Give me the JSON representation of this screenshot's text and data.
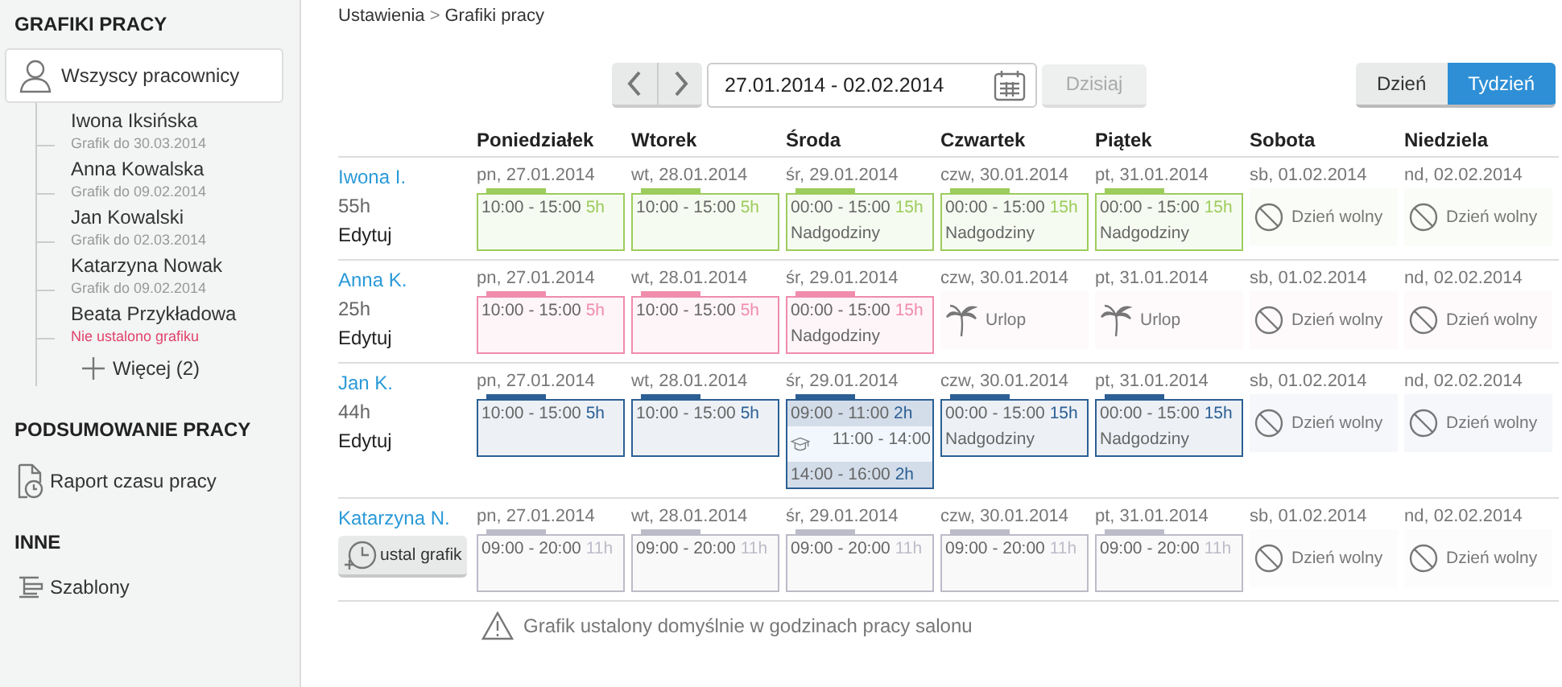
{
  "sidebar": {
    "schedules_title": "GRAFIKI PRACY",
    "all_item": {
      "label": "Wszyscy pracownicy",
      "selected": true
    },
    "employees": [
      {
        "name": "Iwona Iksińska",
        "sub": "Grafik do 30.03.2014",
        "warning": false
      },
      {
        "name": "Anna Kowalska",
        "sub": "Grafik do 09.02.2014",
        "warning": false
      },
      {
        "name": "Jan Kowalski",
        "sub": "Grafik do 02.03.2014",
        "warning": false
      },
      {
        "name": "Katarzyna Nowak",
        "sub": "Grafik do 09.02.2014",
        "warning": false
      },
      {
        "name": "Beata Przykładowa",
        "sub": "Nie ustalono grafiku",
        "warning": true
      }
    ],
    "more": "Więcej (2)",
    "summary_title": "PODSUMOWANIE PRACY",
    "report_item": "Raport czasu pracy",
    "other_title": "INNE",
    "templates_item": "Szablony"
  },
  "breadcrumb": {
    "items": [
      "Ustawienia",
      "Grafiki pracy"
    ],
    "separator": ">"
  },
  "toolbar": {
    "date_range": "27.01.2014 - 02.02.2014",
    "today": {
      "label": "Dzisiaj",
      "disabled": true
    },
    "views": [
      {
        "label": "Dzień",
        "selected": false
      },
      {
        "label": "Tydzień",
        "selected": true
      }
    ]
  },
  "day_headers": [
    "Poniedziałek",
    "Wtorek",
    "Środa",
    "Czwartek",
    "Piątek",
    "Sobota",
    "Niedziela"
  ],
  "rows": [
    {
      "name": "Iwona I.",
      "hours": "55h",
      "action": {
        "kind": "link",
        "label": "Edytuj"
      },
      "color": "#9ccc5c",
      "days": [
        {
          "date": "pn, 27.01.2014",
          "kind": "shift",
          "segments": [
            {
              "kind": "work",
              "time": "10:00 - 15:00",
              "hours": "5h"
            }
          ]
        },
        {
          "date": "wt, 28.01.2014",
          "kind": "shift",
          "segments": [
            {
              "kind": "work",
              "time": "10:00 - 15:00",
              "hours": "5h"
            }
          ]
        },
        {
          "date": "śr, 29.01.2014",
          "kind": "shift",
          "segments": [
            {
              "kind": "work",
              "time": "00:00 - 15:00",
              "hours": "15h",
              "note": "Nadgodziny"
            }
          ]
        },
        {
          "date": "czw, 30.01.2014",
          "kind": "shift",
          "segments": [
            {
              "kind": "work",
              "time": "00:00 - 15:00",
              "hours": "15h",
              "note": "Nadgodziny"
            }
          ]
        },
        {
          "date": "pt, 31.01.2014",
          "kind": "shift",
          "segments": [
            {
              "kind": "work",
              "time": "00:00 - 15:00",
              "hours": "15h",
              "note": "Nadgodziny"
            }
          ]
        },
        {
          "date": "sb, 01.02.2014",
          "kind": "off",
          "label": "Dzień wolny"
        },
        {
          "date": "nd, 02.02.2014",
          "kind": "off",
          "label": "Dzień wolny"
        }
      ]
    },
    {
      "name": "Anna K.",
      "hours": "25h",
      "action": {
        "kind": "link",
        "label": "Edytuj"
      },
      "color": "#f08cac",
      "days": [
        {
          "date": "pn, 27.01.2014",
          "kind": "shift",
          "segments": [
            {
              "kind": "work",
              "time": "10:00 - 15:00",
              "hours": "5h"
            }
          ]
        },
        {
          "date": "wt, 28.01.2014",
          "kind": "shift",
          "segments": [
            {
              "kind": "work",
              "time": "10:00 - 15:00",
              "hours": "5h"
            }
          ]
        },
        {
          "date": "śr, 29.01.2014",
          "kind": "shift",
          "segments": [
            {
              "kind": "work",
              "time": "00:00 - 15:00",
              "hours": "15h",
              "note": "Nadgodziny"
            }
          ]
        },
        {
          "date": "czw, 30.01.2014",
          "kind": "leave",
          "label": "Urlop"
        },
        {
          "date": "pt, 31.01.2014",
          "kind": "leave",
          "label": "Urlop"
        },
        {
          "date": "sb, 01.02.2014",
          "kind": "off",
          "label": "Dzień wolny"
        },
        {
          "date": "nd, 02.02.2014",
          "kind": "off",
          "label": "Dzień wolny"
        }
      ]
    },
    {
      "name": "Jan K.",
      "hours": "44h",
      "action": {
        "kind": "link",
        "label": "Edytuj"
      },
      "color": "#2c5f94",
      "days": [
        {
          "date": "pn, 27.01.2014",
          "kind": "shift",
          "segments": [
            {
              "kind": "work",
              "time": "10:00 - 15:00",
              "hours": "5h"
            }
          ]
        },
        {
          "date": "wt, 28.01.2014",
          "kind": "shift",
          "segments": [
            {
              "kind": "work",
              "time": "10:00 - 15:00",
              "hours": "5h"
            }
          ]
        },
        {
          "date": "śr, 29.01.2014",
          "kind": "shift",
          "segments": [
            {
              "kind": "work",
              "time": "09:00 - 11:00",
              "hours": "2h"
            },
            {
              "kind": "training",
              "time": "11:00 - 14:00"
            },
            {
              "kind": "work",
              "time": "14:00 - 16:00",
              "hours": "2h"
            }
          ]
        },
        {
          "date": "czw, 30.01.2014",
          "kind": "shift",
          "segments": [
            {
              "kind": "work",
              "time": "00:00 - 15:00",
              "hours": "15h",
              "note": "Nadgodziny"
            }
          ]
        },
        {
          "date": "pt, 31.01.2014",
          "kind": "shift",
          "segments": [
            {
              "kind": "work",
              "time": "00:00 - 15:00",
              "hours": "15h",
              "note": "Nadgodziny"
            }
          ]
        },
        {
          "date": "sb, 01.02.2014",
          "kind": "off",
          "label": "Dzień wolny"
        },
        {
          "date": "nd, 02.02.2014",
          "kind": "off",
          "label": "Dzień wolny"
        }
      ]
    },
    {
      "name": "Katarzyna N.",
      "action": {
        "kind": "button",
        "label": "ustal grafik"
      },
      "color": "#bcbcc8",
      "days": [
        {
          "date": "pn, 27.01.2014",
          "kind": "shift",
          "segments": [
            {
              "kind": "work",
              "time": "09:00 - 20:00",
              "hours": "11h"
            }
          ]
        },
        {
          "date": "wt, 28.01.2014",
          "kind": "shift",
          "segments": [
            {
              "kind": "work",
              "time": "09:00 - 20:00",
              "hours": "11h"
            }
          ]
        },
        {
          "date": "śr, 29.01.2014",
          "kind": "shift",
          "segments": [
            {
              "kind": "work",
              "time": "09:00 - 20:00",
              "hours": "11h"
            }
          ]
        },
        {
          "date": "czw, 30.01.2014",
          "kind": "shift",
          "segments": [
            {
              "kind": "work",
              "time": "09:00 - 20:00",
              "hours": "11h"
            }
          ]
        },
        {
          "date": "pt, 31.01.2014",
          "kind": "shift",
          "segments": [
            {
              "kind": "work",
              "time": "09:00 - 20:00",
              "hours": "11h"
            }
          ]
        },
        {
          "date": "sb, 01.02.2014",
          "kind": "off",
          "label": "Dzień wolny"
        },
        {
          "date": "nd, 02.02.2014",
          "kind": "off",
          "label": "Dzień wolny"
        }
      ]
    }
  ],
  "footer_note": "Grafik ustalony domyślnie w godzinach pracy salonu"
}
